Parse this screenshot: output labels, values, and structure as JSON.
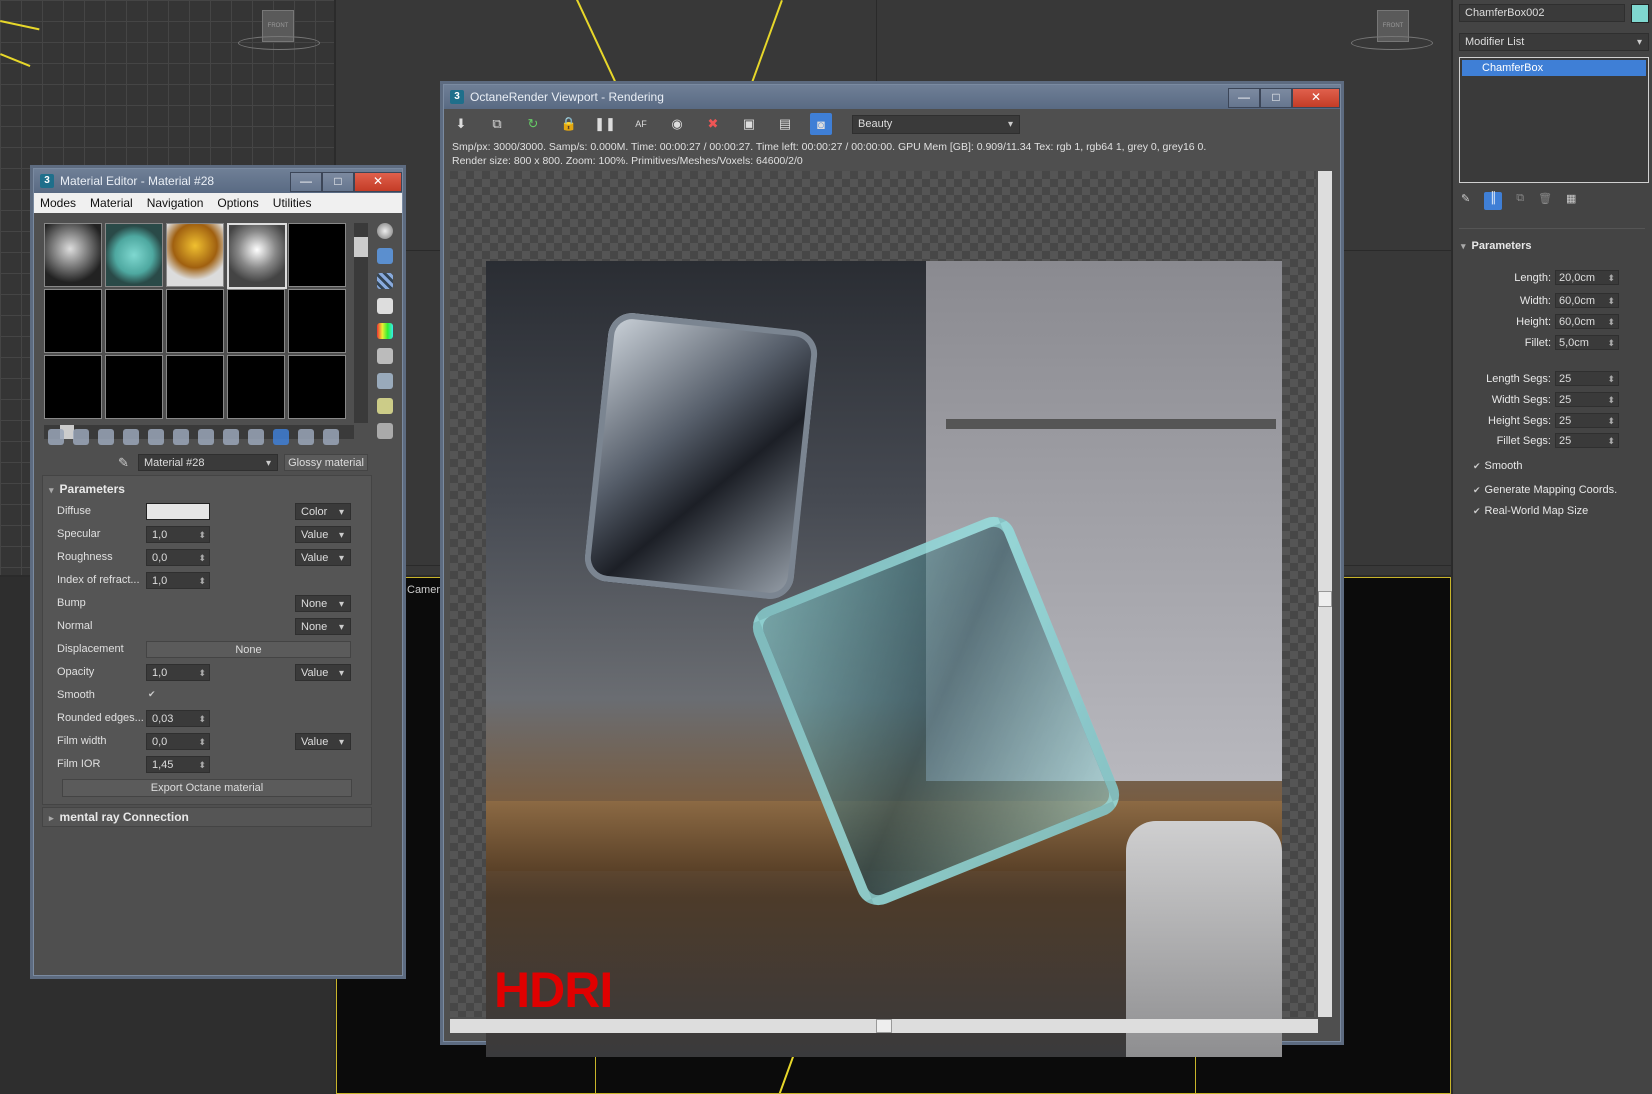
{
  "colors": {
    "accent": "#3f7fd6",
    "hdri": "#e00000",
    "viewport_line": "#e7d72a",
    "object_color": "#7fd8d0"
  },
  "viewport": {
    "cube_label": "FRONT",
    "camera_label": "Camera"
  },
  "material_editor": {
    "title": "Material Editor - Material #28",
    "app_icon": "3",
    "window_buttons": {
      "minimize": "—",
      "maximize": "□",
      "close": "✕"
    },
    "menu": [
      "Modes",
      "Material",
      "Navigation",
      "Options",
      "Utilities"
    ],
    "material_name": "Material #28",
    "material_type": "Glossy material",
    "parameters_title": "Parameters",
    "params": {
      "diffuse": {
        "label": "Diffuse",
        "mode": "Color"
      },
      "specular": {
        "label": "Specular",
        "value": "1,0",
        "mode": "Value"
      },
      "roughness": {
        "label": "Roughness",
        "value": "0,0",
        "mode": "Value"
      },
      "ior": {
        "label": "Index of refract...",
        "value": "1,0"
      },
      "bump": {
        "label": "Bump",
        "mode": "None"
      },
      "normal": {
        "label": "Normal",
        "mode": "None"
      },
      "displacement": {
        "label": "Displacement",
        "button": "None"
      },
      "opacity": {
        "label": "Opacity",
        "value": "1,0",
        "mode": "Value"
      },
      "smooth": {
        "label": "Smooth",
        "check": "✔"
      },
      "rounded": {
        "label": "Rounded edges...",
        "value": "0,03"
      },
      "film_width": {
        "label": "Film width",
        "value": "0,0",
        "mode": "Value"
      },
      "film_ior": {
        "label": "Film IOR",
        "value": "1,45"
      }
    },
    "export_button": "Export Octane material",
    "mental_ray_title": "mental ray Connection"
  },
  "octane": {
    "title": "OctaneRender Viewport - Rendering",
    "app_icon": "3",
    "window_buttons": {
      "minimize": "—",
      "maximize": "□",
      "close": "✕"
    },
    "pass": "Beauty",
    "status_line1": "Smp/px: 3000/3000.   Samp/s: 0.000M.   Time: 00:00:27 / 00:00:27.   Time left: 00:00:27 / 00:00:00.   GPU Mem [GB]: 0.909/11.34   Tex: rgb 1, rgb64 1, grey 0, grey16 0.",
    "status_line2": "Render size: 800 x 800.   Zoom: 100%.   Primitives/Meshes/Voxels: 64600/2/0",
    "render_label": "HDRI"
  },
  "right_panel": {
    "object_name": "ChamferBox002",
    "modifier_list": "Modifier List",
    "stack_item": "ChamferBox",
    "parameters_title": "Parameters",
    "params": [
      {
        "label": "Length:",
        "value": "20,0cm"
      },
      {
        "label": "Width:",
        "value": "60,0cm"
      },
      {
        "label": "Height:",
        "value": "60,0cm"
      },
      {
        "label": "Fillet:",
        "value": "5,0cm"
      },
      {
        "label": "Length Segs:",
        "value": "25"
      },
      {
        "label": "Width Segs:",
        "value": "25"
      },
      {
        "label": "Height Segs:",
        "value": "25"
      },
      {
        "label": "Fillet Segs:",
        "value": "25"
      }
    ],
    "checks": [
      "Smooth",
      "Generate Mapping Coords.",
      "Real-World Map Size"
    ]
  }
}
